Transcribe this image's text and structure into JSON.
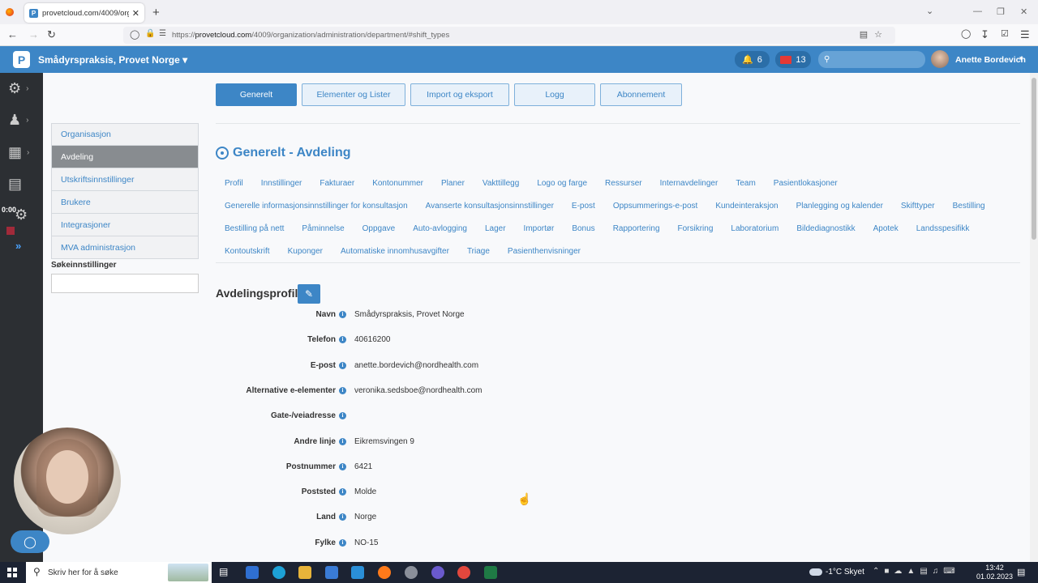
{
  "browser": {
    "tab_title": "provetcloud.com/4009/organiz",
    "tab_close": "✕",
    "new_tab": "+",
    "url_prefix": "https://",
    "url_host": "provetcloud.com",
    "url_path": "/4009/organization/administration/department/#shift_types"
  },
  "app": {
    "logo": "P",
    "title": "Smådyrspraksis, Provet Norge",
    "notifications": "6",
    "messages": "13",
    "user": "Anette Bordevich"
  },
  "rail": {
    "timer": "0:00"
  },
  "sidebar": {
    "items": [
      {
        "label": "Organisasjon"
      },
      {
        "label": "Avdeling"
      },
      {
        "label": "Utskriftsinnstillinger"
      },
      {
        "label": "Brukere"
      },
      {
        "label": "Integrasjoner"
      },
      {
        "label": "MVA administrasjon"
      }
    ],
    "search_label": "Søkeinnstillinger"
  },
  "top_buttons": [
    "Generelt",
    "Elementer og Lister",
    "Import og eksport",
    "Logg",
    "Abonnement"
  ],
  "section_title": "Generelt - Avdeling",
  "subnav": {
    "row1": [
      "Profil",
      "Innstillinger",
      "Fakturaer",
      "Kontonummer",
      "Planer",
      "Vakttillegg",
      "Logo og farge",
      "Ressurser",
      "Internavdelinger",
      "Team",
      "Pasientlokasjoner"
    ],
    "row2": [
      "Generelle informasjonsinnstillinger for konsultasjon",
      "Avanserte konsultasjonsinnstillinger",
      "E-post",
      "Oppsummerings-e-post",
      "Kundeinteraksjon",
      "Planlegging og kalender",
      "Skifttyper",
      "Bestilling"
    ],
    "row3": [
      "Bestilling på nett",
      "Påminnelse",
      "Oppgave",
      "Auto-avlogging",
      "Lager",
      "Importør",
      "Bonus",
      "Rapportering",
      "Forsikring",
      "Laboratorium",
      "Bildediagnostikk",
      "Apotek",
      "Landsspesifikk"
    ],
    "row4": [
      "Kontoutskrift",
      "Kuponger",
      "Automatiske innomhusavgifter",
      "Triage",
      "Pasienthenvisninger"
    ]
  },
  "profile": {
    "heading": "Avdelingsprofil",
    "fields": [
      {
        "label": "Navn",
        "value": "Smådyrspraksis, Provet Norge"
      },
      {
        "label": "Telefon",
        "value": "40616200"
      },
      {
        "label": "E-post",
        "value": "anette.bordevich@nordhealth.com"
      },
      {
        "label": "Alternative e-elementer",
        "value": "veronika.sedsboe@nordhealth.com"
      },
      {
        "label": "Gate-/veiadresse",
        "value": ""
      },
      {
        "label": "Andre linje",
        "value": "Eikremsvingen 9"
      },
      {
        "label": "Postnummer",
        "value": "6421"
      },
      {
        "label": "Poststed",
        "value": "Molde"
      },
      {
        "label": "Land",
        "value": "Norge"
      },
      {
        "label": "Fylke",
        "value": "NO-15"
      }
    ]
  },
  "taskbar": {
    "search_placeholder": "Skriv her for å søke",
    "weather": "-1°C  Skyet",
    "time": "13:42",
    "date": "01.02.2023"
  }
}
